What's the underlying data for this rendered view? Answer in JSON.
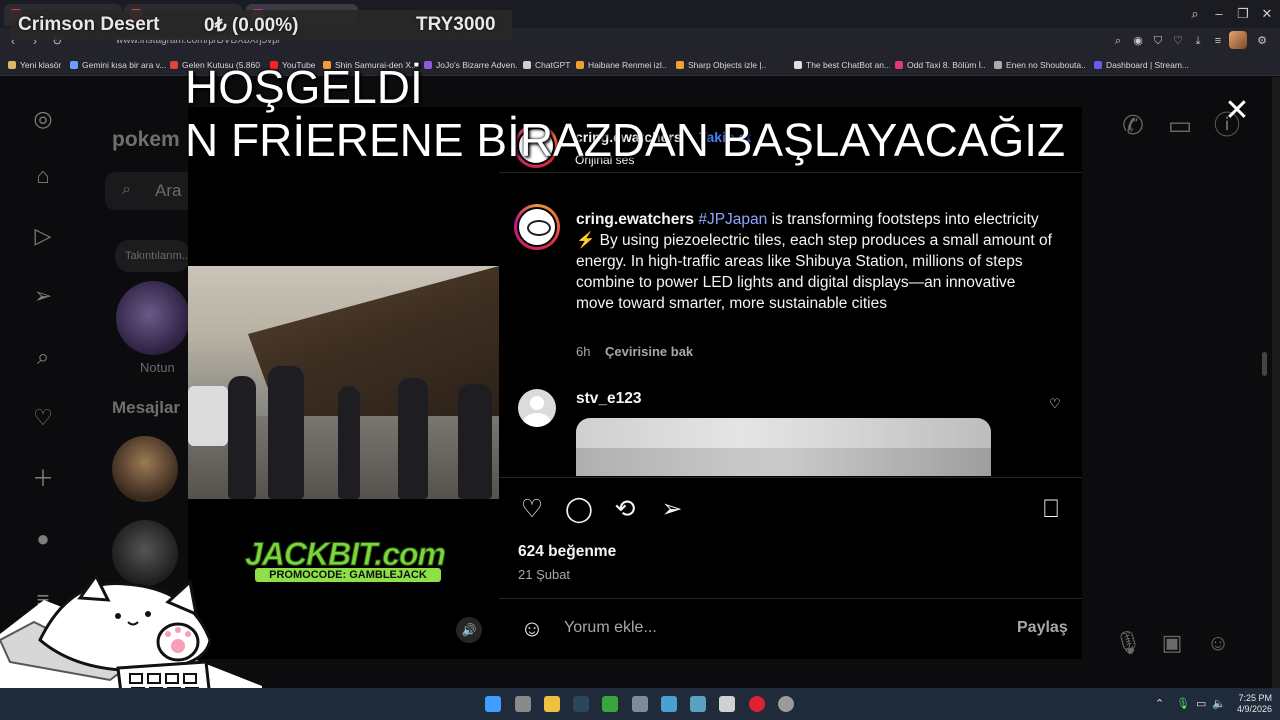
{
  "browser": {
    "tabs": [
      "",
      "",
      "",
      ""
    ],
    "url": "www.instagram.com/p/DVBXbXrj5vp/",
    "bookmarks": [
      "Yeni klasör",
      "Gemini kısa bir ara v...",
      "Gelen Kutusu (5.860...",
      "YouTube",
      "Shin Samurai-den X...",
      "JoJo's Bizarre Adven...",
      "ChatGPT",
      "Haibane Renmei izl...",
      "Sharp Objects izle |...",
      "The best ChatBot an...",
      "Odd Taxi 8. Bölüm İ...",
      "Enen no Shoubouta...",
      "Dashboard | Stream..."
    ]
  },
  "stream": {
    "game": "Crimson Desert",
    "counter": "0₺ (0.00%)",
    "goal": "TRY3000"
  },
  "overlay": {
    "line1": "HOŞGELDİ",
    "line2": "N FRİERENE BİRAZDAN BAŞLAYACAĞIZ"
  },
  "instagram_bg": {
    "title": "pokem",
    "search_placeholder": "Ara",
    "note_bubble": "Takıntılarım...",
    "note_label": "Notun",
    "messages_title": "Mesajlar"
  },
  "post": {
    "header_username": "cring.ewatchers",
    "header_dot": "•",
    "follow_label": "Takip et",
    "audio": "Orijinal ses",
    "caption_username": "cring.ewatchers",
    "caption_hashtag": "#JPJapan",
    "caption_text1": " is transforming footsteps into electricity ",
    "caption_bolt": "⚡",
    "caption_text2": " By using piezoelectric tiles, each step produces a small amount of energy. In high-traffic areas like Shibuya Station, millions of steps combine to power LED lights and digital displays—an innovative move toward smarter, more sustainable cities",
    "caption_time": "6h",
    "translate_label": "Çevirisine bak",
    "comment_username": "stv_e123",
    "likes": "624 beğenme",
    "date": "21 Şubat",
    "comment_placeholder": "Yorum ekle...",
    "share_label": "Paylaş"
  },
  "sponsor": {
    "name": "JACKBIT.com",
    "promo": "PROMOCODE: GAMBLEJACK"
  },
  "taskbar": {
    "time": "7:25 PM",
    "date": "4/9/2026"
  },
  "colors": {
    "accent_blue": "#4c7cf0",
    "hashtag": "#8ea6ff",
    "jackbit_green": "#7cd63a"
  }
}
